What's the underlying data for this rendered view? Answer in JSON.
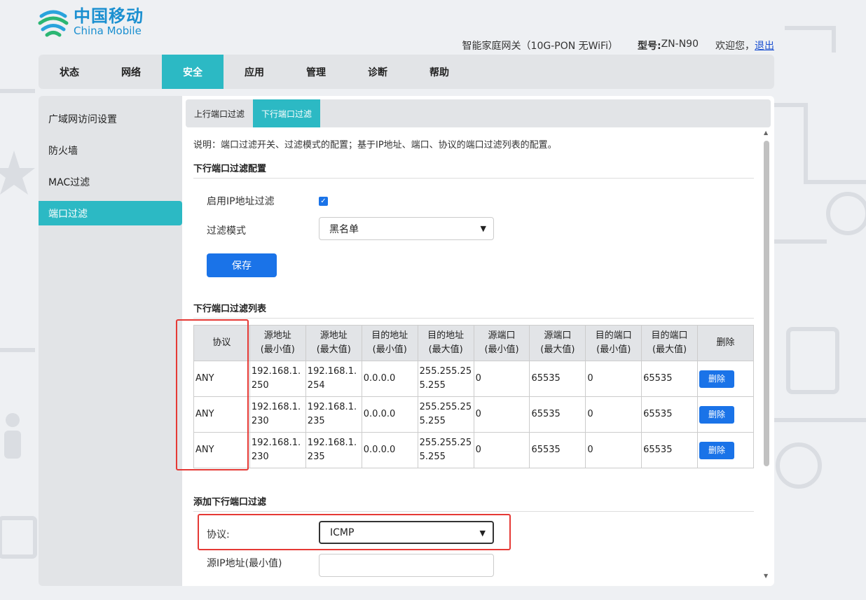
{
  "brand": {
    "cn": "中国移动",
    "en": "China Mobile",
    "accent": "#2cb9c4",
    "button_color": "#1a73e8"
  },
  "top_info": {
    "product": "智能家庭网关（10G-PON 无WiFi）",
    "model_label": "型号:",
    "model_value": "ZN-N90",
    "welcome": "欢迎您，",
    "logout": "退出"
  },
  "nav": {
    "items": [
      "状态",
      "网络",
      "安全",
      "应用",
      "管理",
      "诊断",
      "帮助"
    ],
    "active": "安全"
  },
  "sidebar": {
    "items": [
      "广域网访问设置",
      "防火墙",
      "MAC过滤",
      "端口过滤"
    ],
    "active": "端口过滤"
  },
  "subtabs": {
    "items": [
      "上行端口过滤",
      "下行端口过滤"
    ],
    "active": "下行端口过滤"
  },
  "description": "说明：端口过滤开关、过滤模式的配置；基于IP地址、端口、协议的端口过滤列表的配置。",
  "config": {
    "title": "下行端口过滤配置",
    "enable_label": "启用IP地址过滤",
    "enable_checked": true,
    "mode_label": "过滤模式",
    "mode_value": "黑名单",
    "save_label": "保存"
  },
  "list": {
    "title": "下行端口过滤列表",
    "headers": [
      [
        "协议"
      ],
      [
        "源地址",
        "(最小值)"
      ],
      [
        "源地址",
        "(最大值)"
      ],
      [
        "目的地址",
        "(最小值)"
      ],
      [
        "目的地址",
        "(最大值)"
      ],
      [
        "源端口",
        "(最小值)"
      ],
      [
        "源端口",
        "(最大值)"
      ],
      [
        "目的端口",
        "(最小值)"
      ],
      [
        "目的端口",
        "(最大值)"
      ],
      [
        "删除"
      ]
    ],
    "rows": [
      {
        "protocol": "ANY",
        "src_min": [
          "192.168.1.",
          "250"
        ],
        "src_max": [
          "192.168.1.",
          "254"
        ],
        "dst_min": "0.0.0.0",
        "dst_max": [
          "255.255.25",
          "5.255"
        ],
        "sport_min": "0",
        "sport_max": "65535",
        "dport_min": "0",
        "dport_max": "65535"
      },
      {
        "protocol": "ANY",
        "src_min": [
          "192.168.1.",
          "230"
        ],
        "src_max": [
          "192.168.1.",
          "235"
        ],
        "dst_min": "0.0.0.0",
        "dst_max": [
          "255.255.25",
          "5.255"
        ],
        "sport_min": "0",
        "sport_max": "65535",
        "dport_min": "0",
        "dport_max": "65535"
      },
      {
        "protocol": "ANY",
        "src_min": [
          "192.168.1.",
          "230"
        ],
        "src_max": [
          "192.168.1.",
          "235"
        ],
        "dst_min": "0.0.0.0",
        "dst_max": [
          "255.255.25",
          "5.255"
        ],
        "sport_min": "0",
        "sport_max": "65535",
        "dport_min": "0",
        "dport_max": "65535"
      }
    ],
    "delete_label": "删除"
  },
  "add": {
    "title": "添加下行端口过滤",
    "protocol_label": "协议:",
    "protocol_value": "ICMP",
    "src_min_label": "源IP地址(最小值)",
    "src_min_value": ""
  },
  "highlight_color": "#e53935"
}
